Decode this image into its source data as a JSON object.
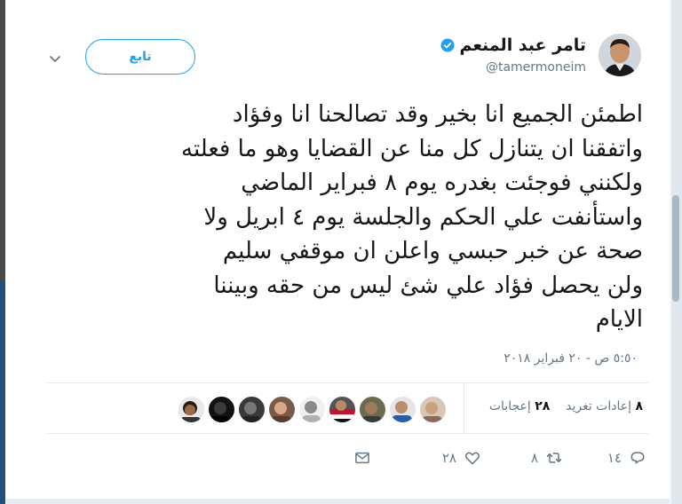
{
  "user": {
    "display_name": "تامر عبد المنعم",
    "handle": "@tamermoneim",
    "verified": true,
    "avatar_icon": "profile-photo"
  },
  "follow_button": {
    "label": "تابع"
  },
  "tweet": {
    "lines": [
      "اطمئن الجميع انا بخير وقد تصالحنا انا وفؤاد",
      "واتفقنا ان يتنازل كل منا عن القضايا وهو ما فعلته",
      "ولكنني فوجئت بغدره يوم ٨ فبراير الماضي",
      "واستأنفت علي الحكم والجلسة يوم ٤ ابريل ولا",
      "صحة عن خبر حبسي واعلن ان موقفي سليم",
      "ولن يحصل فؤاد علي شئ ليس من حقه وبيننا",
      "الايام"
    ],
    "timestamp": "٥:٥٠ ص - ٢٠ فبراير ٢٠١٨"
  },
  "stats": {
    "retweets_count": "٨",
    "retweets_label": "إعادات تغريد",
    "likes_count": "٢٨",
    "likes_label": "إعجابات"
  },
  "actions": {
    "reply_count": "١٤",
    "retweet_count": "٨",
    "like_count": "٢٨"
  },
  "colors": {
    "accent": "#1da1f2",
    "text": "#14171a",
    "muted": "#657786",
    "divider": "#e6ecf0"
  }
}
